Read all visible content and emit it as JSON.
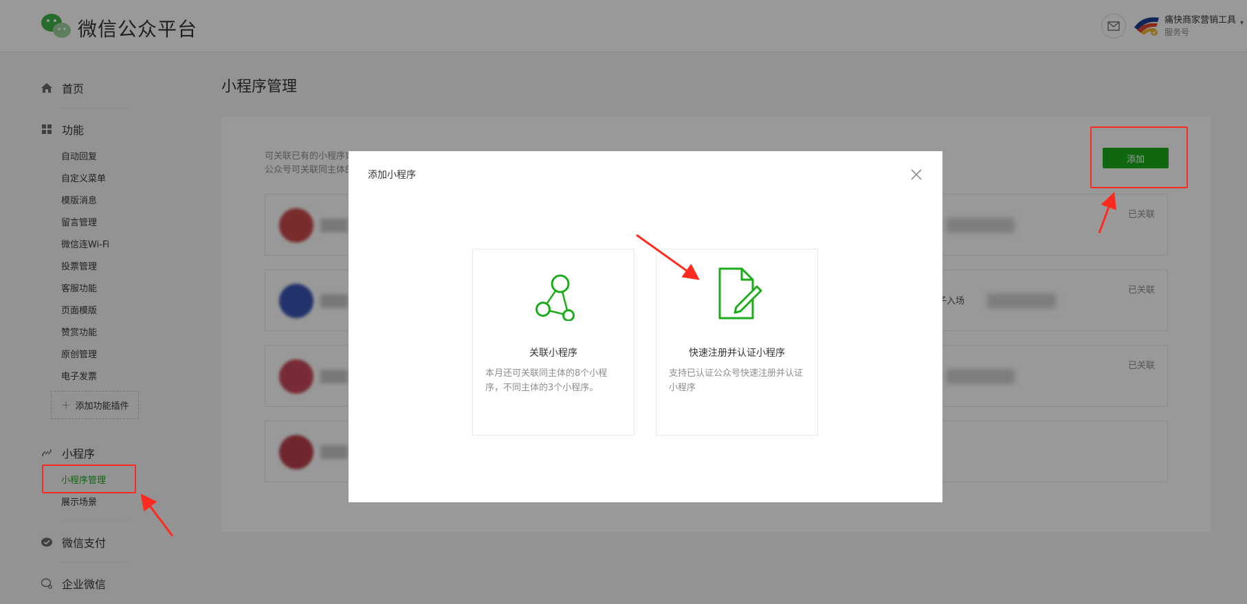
{
  "header": {
    "brand": "微信公众平台",
    "account_name": "痛快商家营销工具",
    "account_type": "服务号"
  },
  "sidebar": {
    "home": "首页",
    "features": "功能",
    "feature_items": [
      "自动回复",
      "自定义菜单",
      "模版消息",
      "留言管理",
      "微信连Wi-Fi",
      "投票管理",
      "客服功能",
      "页面模版",
      "赞赏功能",
      "原创管理",
      "电子发票"
    ],
    "add_plugin": "添加功能插件",
    "miniprogram": "小程序",
    "miniprogram_items": [
      "小程序管理",
      "展示场景"
    ],
    "wechat_pay": "微信支付",
    "enterprise_wechat": "企业微信"
  },
  "main": {
    "title": "小程序管理",
    "desc_line1": "可关联已有的小程序或",
    "desc_line2": "公众号可关联同主体的",
    "add_button": "添加",
    "linked_status": "已关联",
    "card_right_text": "子入场"
  },
  "dialog": {
    "title": "添加小程序",
    "options": [
      {
        "title": "关联小程序",
        "desc": "本月还可关联同主体的8个小程序，不同主体的3个小程序。"
      },
      {
        "title": "快速注册并认证小程序",
        "desc": "支持已认证公众号快速注册并认证小程序"
      }
    ]
  },
  "colors": {
    "primary_green": "#1aad19",
    "annotation_red": "#ff2a1f"
  }
}
